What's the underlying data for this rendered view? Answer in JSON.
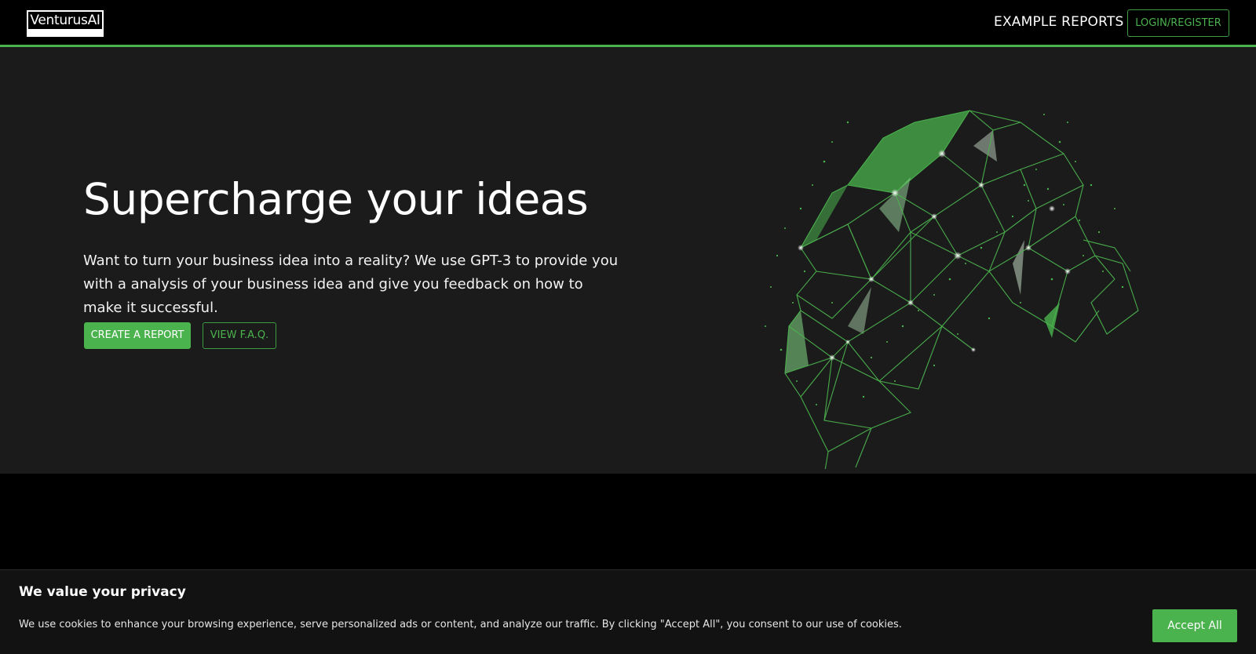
{
  "header": {
    "logo_text": "VenturusAI",
    "nav_reports": "EXAMPLE REPORTS",
    "login_label": "LOGIN/REGISTER"
  },
  "hero": {
    "title": "Supercharge your ideas",
    "subtitle": "Want to turn your business idea into a reality? We use GPT-3 to provide you with a analysis of your business idea and give you feedback on how to make it successful.",
    "create_label": "CREATE A REPORT",
    "faq_label": "VIEW F.A.Q.",
    "illustration": "polygonal-green-head-icon"
  },
  "cookie": {
    "title": "We value your privacy",
    "text": "We use cookies to enhance your browsing experience, serve personalized ads or content, and analyze our traffic. By clicking \"Accept All\", you consent to our use of cookies.",
    "accept_label": "Accept All"
  },
  "colors": {
    "accent": "#4bb34e",
    "hero_bg": "#1b1b1b",
    "page_bg": "#000000",
    "banner_bg": "#121212"
  }
}
